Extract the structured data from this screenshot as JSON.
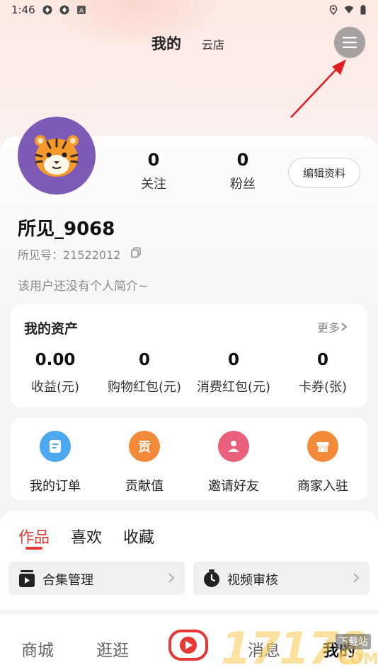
{
  "status_bar": {
    "time": "1:46",
    "left_icons": [
      "app-icon",
      "app-icon",
      "a-badge-icon"
    ],
    "right_icons": [
      "location-icon",
      "wifi-icon",
      "battery-icon"
    ]
  },
  "header": {
    "title": "我的",
    "tab": "云店",
    "menu_icon": "hamburger-menu-icon"
  },
  "profile": {
    "avatar": "tiger-avatar",
    "following_count": "0",
    "following_label": "关注",
    "fans_count": "0",
    "fans_label": "粉丝",
    "edit_label": "编辑资料",
    "username": "所见_9068",
    "user_id": "所见号：21522012",
    "bio": "该用户还没有个人简介~"
  },
  "assets": {
    "title": "我的资产",
    "more_label": "更多",
    "items": [
      {
        "value": "0.00",
        "label": "收益(元)"
      },
      {
        "value": "0",
        "label": "购物红包(元)"
      },
      {
        "value": "0",
        "label": "消费红包(元)"
      },
      {
        "value": "0",
        "label": "卡券(张)"
      }
    ]
  },
  "shortcuts": [
    {
      "label": "我的订单",
      "icon": "order-icon",
      "color": "#4da8f0"
    },
    {
      "label": "贡献值",
      "icon": "contribution-icon",
      "color": "#f28a3a"
    },
    {
      "label": "邀请好友",
      "icon": "invite-icon",
      "color": "#e8607a"
    },
    {
      "label": "商家入驻",
      "icon": "store-icon",
      "color": "#f28a3a"
    }
  ],
  "content_tabs": [
    {
      "label": "作品",
      "active": true
    },
    {
      "label": "喜欢",
      "active": false
    },
    {
      "label": "收藏",
      "active": false
    }
  ],
  "tools": [
    {
      "label": "合集管理",
      "icon": "collection-icon"
    },
    {
      "label": "视频审核",
      "icon": "clock-icon"
    }
  ],
  "bottom_nav": [
    {
      "label": "商城"
    },
    {
      "label": "逛逛"
    },
    {
      "label": "消息"
    },
    {
      "label": "我的",
      "active": true
    }
  ],
  "watermark": {
    "text": "17178",
    "sub": "下载站",
    "domain": "COM"
  },
  "colors": {
    "accent": "#e53935",
    "avatar_bg": "#7d5ab6"
  }
}
